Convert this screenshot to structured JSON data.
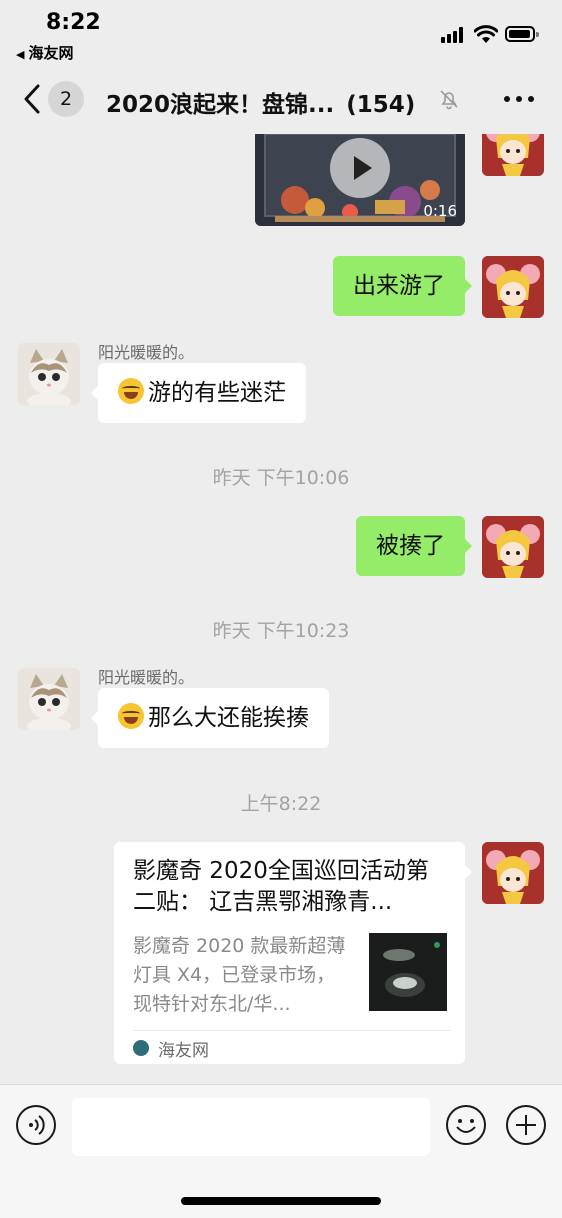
{
  "status_bar": {
    "time": "8:22",
    "back_app": "海友网"
  },
  "header": {
    "back_badge": "2",
    "title": "2020浪起来！盘锦...",
    "member_count": "(154)",
    "mute_icon": "bell-slash-icon",
    "more_icon": "more-dots-icon"
  },
  "messages": [
    {
      "type": "video",
      "side": "right",
      "duration": "0:16"
    },
    {
      "type": "text",
      "side": "right",
      "text": "出来游了"
    },
    {
      "type": "text",
      "side": "left",
      "sender": "阳光暖暖的。",
      "emoji": "laughing-tears-emoji",
      "text": "游的有些迷茫"
    },
    {
      "type": "timestamp",
      "text": "昨天 下午10:06"
    },
    {
      "type": "text",
      "side": "right",
      "text": "被揍了"
    },
    {
      "type": "timestamp",
      "text": "昨天 下午10:23"
    },
    {
      "type": "text",
      "side": "left",
      "sender": "阳光暖暖的。",
      "emoji": "rolling-laugh-emoji",
      "text": "那么大还能挨揍"
    },
    {
      "type": "timestamp",
      "text": "上午8:22"
    },
    {
      "type": "link_card",
      "side": "right",
      "title": "影魔奇 2020全国巡回活动第二贴： 辽吉黑鄂湘豫青...",
      "description": "影魔奇 2020 款最新超薄灯具 X4，已登录市场，现特针对东北/华...",
      "source": "海友网"
    }
  ],
  "input_bar": {
    "voice_icon": "voice-icon",
    "emoji_icon": "smile-icon",
    "plus_icon": "plus-icon",
    "placeholder": ""
  },
  "colors": {
    "background": "#ededed",
    "self_bubble": "#95ec69",
    "other_bubble": "#ffffff",
    "avatar_self_bg": "#a8322b"
  }
}
